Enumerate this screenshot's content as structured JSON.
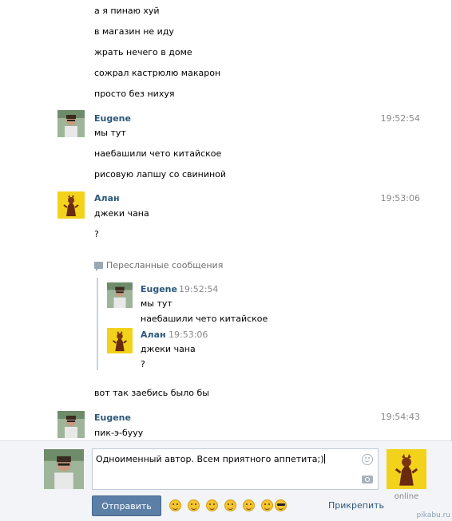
{
  "messages": {
    "top_lines": [
      "а я пинаю хуй",
      "в магазин не иду",
      "жрать нечего в доме",
      "сожрал кастрюлю макарон",
      "просто без нихуя"
    ],
    "group1": {
      "sender": "Eugene",
      "time": "19:52:54",
      "lines": [
        "мы тут",
        "наебашили чето китайское",
        "рисовую лапшу со свининой"
      ]
    },
    "group2": {
      "sender": "Алан",
      "time": "19:53:06",
      "lines": [
        "джеки чана",
        "?"
      ],
      "forwarded_header": "Пересланные сообщения",
      "forwarded": [
        {
          "sender": "Eugene",
          "time": "19:52:54",
          "lines": [
            "мы тут",
            "наебашили чето китайское"
          ]
        },
        {
          "sender": "Алан",
          "time": "19:53:06",
          "lines": [
            "джеки чана",
            "?"
          ]
        }
      ],
      "after_forward": "вот так заебись было бы"
    },
    "group3": {
      "sender": "Eugene",
      "time": "19:54:43",
      "lines": [
        "пик-э-бууу"
      ]
    }
  },
  "composer": {
    "input_value": "Одноименный автор. Всем приятного аппетита;)",
    "send_label": "Отправить",
    "attach_label": "Прикрепить",
    "status": "online",
    "emoji": [
      "smile",
      "sad",
      "grin",
      "wink",
      "kiss",
      "happy",
      "cool"
    ]
  },
  "watermark": "pikabu.ru",
  "colors": {
    "link": "#2b587a",
    "send_button": "#5b7fa6",
    "time": "#888888"
  }
}
